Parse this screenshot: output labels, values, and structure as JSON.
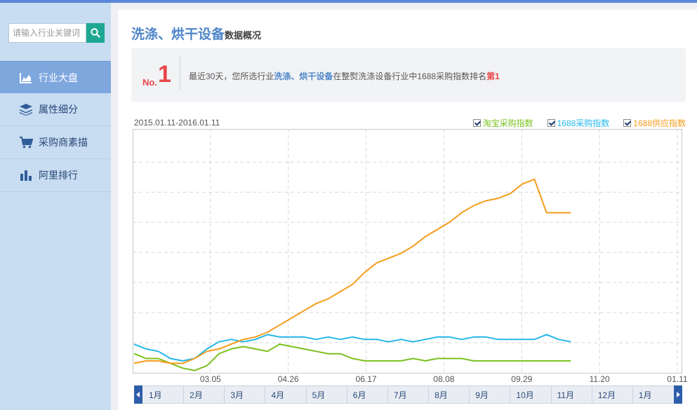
{
  "sidebar": {
    "search_placeholder": "请输入行业关键词",
    "items": [
      {
        "label": "行业大盘",
        "icon": "area-chart-icon"
      },
      {
        "label": "属性细分",
        "icon": "layers-icon"
      },
      {
        "label": "采购商素描",
        "icon": "cart-icon"
      },
      {
        "label": "阿里排行",
        "icon": "bar-chart-icon"
      }
    ]
  },
  "header": {
    "title": "洗涤、烘干设备",
    "subtitle": "数据概况"
  },
  "rank": {
    "no_label": "No.",
    "number": "1",
    "text_prefix": "最近30天，您所选行业",
    "industry": "洗涤、烘干设备",
    "text_middle": "在整熨洗涤设备行业中1688采购指数排名",
    "rank_text": "第1"
  },
  "chart_data": {
    "type": "line",
    "date_range": "2015.01.11-2016.01.11",
    "x_tick_labels": [
      "03.05",
      "04.26",
      "06.17",
      "08.08",
      "09.29",
      "11.20",
      "01.11"
    ],
    "x": [
      "01.11",
      "01.19",
      "01.27",
      "02.04",
      "02.12",
      "02.20",
      "02.28",
      "03.08",
      "03.16",
      "03.24",
      "04.01",
      "04.09",
      "04.17",
      "04.25",
      "05.03",
      "05.11",
      "05.19",
      "05.27",
      "06.04",
      "06.12",
      "06.20",
      "06.28",
      "07.06",
      "07.14",
      "07.22",
      "07.30",
      "08.07",
      "08.15",
      "08.23",
      "08.31",
      "09.08",
      "09.16",
      "09.24",
      "10.02",
      "10.10",
      "10.18",
      "10.26"
    ],
    "ylim": [
      0,
      100
    ],
    "grid": true,
    "legend_position": "top-right",
    "series": [
      {
        "name": "淘宝采购指数",
        "color": "#7ac11e",
        "values": [
          8,
          6,
          6,
          4,
          2,
          1,
          3,
          8,
          10,
          11,
          10,
          9,
          12,
          11,
          10,
          9,
          8,
          8,
          6,
          5,
          5,
          5,
          5,
          6,
          5,
          6,
          6,
          6,
          5,
          5,
          5,
          5,
          5,
          5,
          5,
          5,
          5
        ]
      },
      {
        "name": "1688采购指数",
        "color": "#25b7ea",
        "values": [
          12,
          10,
          9,
          6,
          5,
          6,
          10,
          13,
          14,
          13,
          14,
          16,
          15,
          15,
          15,
          14,
          15,
          14,
          15,
          14,
          14,
          13,
          14,
          13,
          14,
          15,
          15,
          14,
          15,
          15,
          14,
          14,
          14,
          14,
          16,
          14,
          13
        ]
      },
      {
        "name": "1688供应指数",
        "color": "#f59c1a",
        "values": [
          4,
          5,
          5,
          4,
          4,
          6,
          9,
          10,
          12,
          14,
          15,
          17,
          20,
          23,
          26,
          29,
          31,
          34,
          37,
          42,
          46,
          48,
          50,
          53,
          57,
          60,
          63,
          67,
          70,
          72,
          73,
          75,
          79,
          81,
          67,
          67,
          67
        ]
      }
    ]
  },
  "timeline": {
    "months": [
      "1月",
      "2月",
      "3月",
      "4月",
      "5月",
      "6月",
      "7月",
      "8月",
      "9月",
      "10月",
      "11月",
      "12月",
      "1月"
    ]
  },
  "colors": {
    "accent": "#4f86c9",
    "rank_red": "#e8464a",
    "search_button": "#1ea894",
    "sidebar_bg": "#c8dcf2",
    "nav_active": "#7ea7de"
  }
}
